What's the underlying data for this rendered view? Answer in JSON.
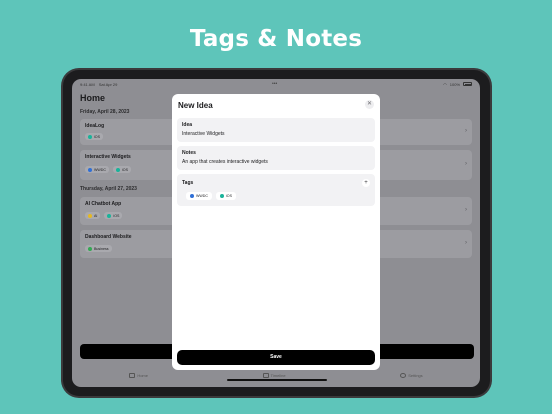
{
  "headline": "Tags & Notes",
  "colors": {
    "background": "#5ec5ba",
    "blue_tag": "#2f6fd6",
    "teal_tag": "#19b39a",
    "yellow_tag": "#e6b820",
    "green_tag": "#34a853"
  },
  "statusbar": {
    "time": "9:41 AM",
    "date": "Sat Apr 29",
    "battery": "100%"
  },
  "home": {
    "title": "Home",
    "sections": [
      {
        "date": "Friday, April 28, 2023",
        "cards": [
          {
            "title": "IdeaLog",
            "tags": [
              {
                "label": "iOS",
                "color": "teal"
              }
            ]
          },
          {
            "title": "Interactive Widgets",
            "tags": [
              {
                "label": "WWDC",
                "color": "blue"
              },
              {
                "label": "iOS",
                "color": "teal"
              }
            ]
          }
        ]
      },
      {
        "date": "Thursday, April 27, 2023",
        "cards": [
          {
            "title": "AI Chatbot App",
            "tags": [
              {
                "label": "AI",
                "color": "yellow"
              },
              {
                "label": "iOS",
                "color": "teal"
              }
            ]
          },
          {
            "title": "Dashboard Website",
            "tags": [
              {
                "label": "Business",
                "color": "green"
              }
            ]
          }
        ]
      }
    ],
    "tabs": [
      {
        "label": "Home",
        "icon": "house-icon"
      },
      {
        "label": "Timeline",
        "icon": "calendar-icon"
      },
      {
        "label": "Settings",
        "icon": "gear-icon"
      }
    ]
  },
  "sheet": {
    "title": "New Idea",
    "idea_label": "Idea",
    "idea_value": "Interactive Widgets",
    "notes_label": "Notes",
    "notes_value": "An app that creates interactive widgets",
    "tags_label": "Tags",
    "tags": [
      {
        "label": "WWDC",
        "color": "blue"
      },
      {
        "label": "iOS",
        "color": "teal"
      }
    ],
    "save_label": "Save"
  }
}
